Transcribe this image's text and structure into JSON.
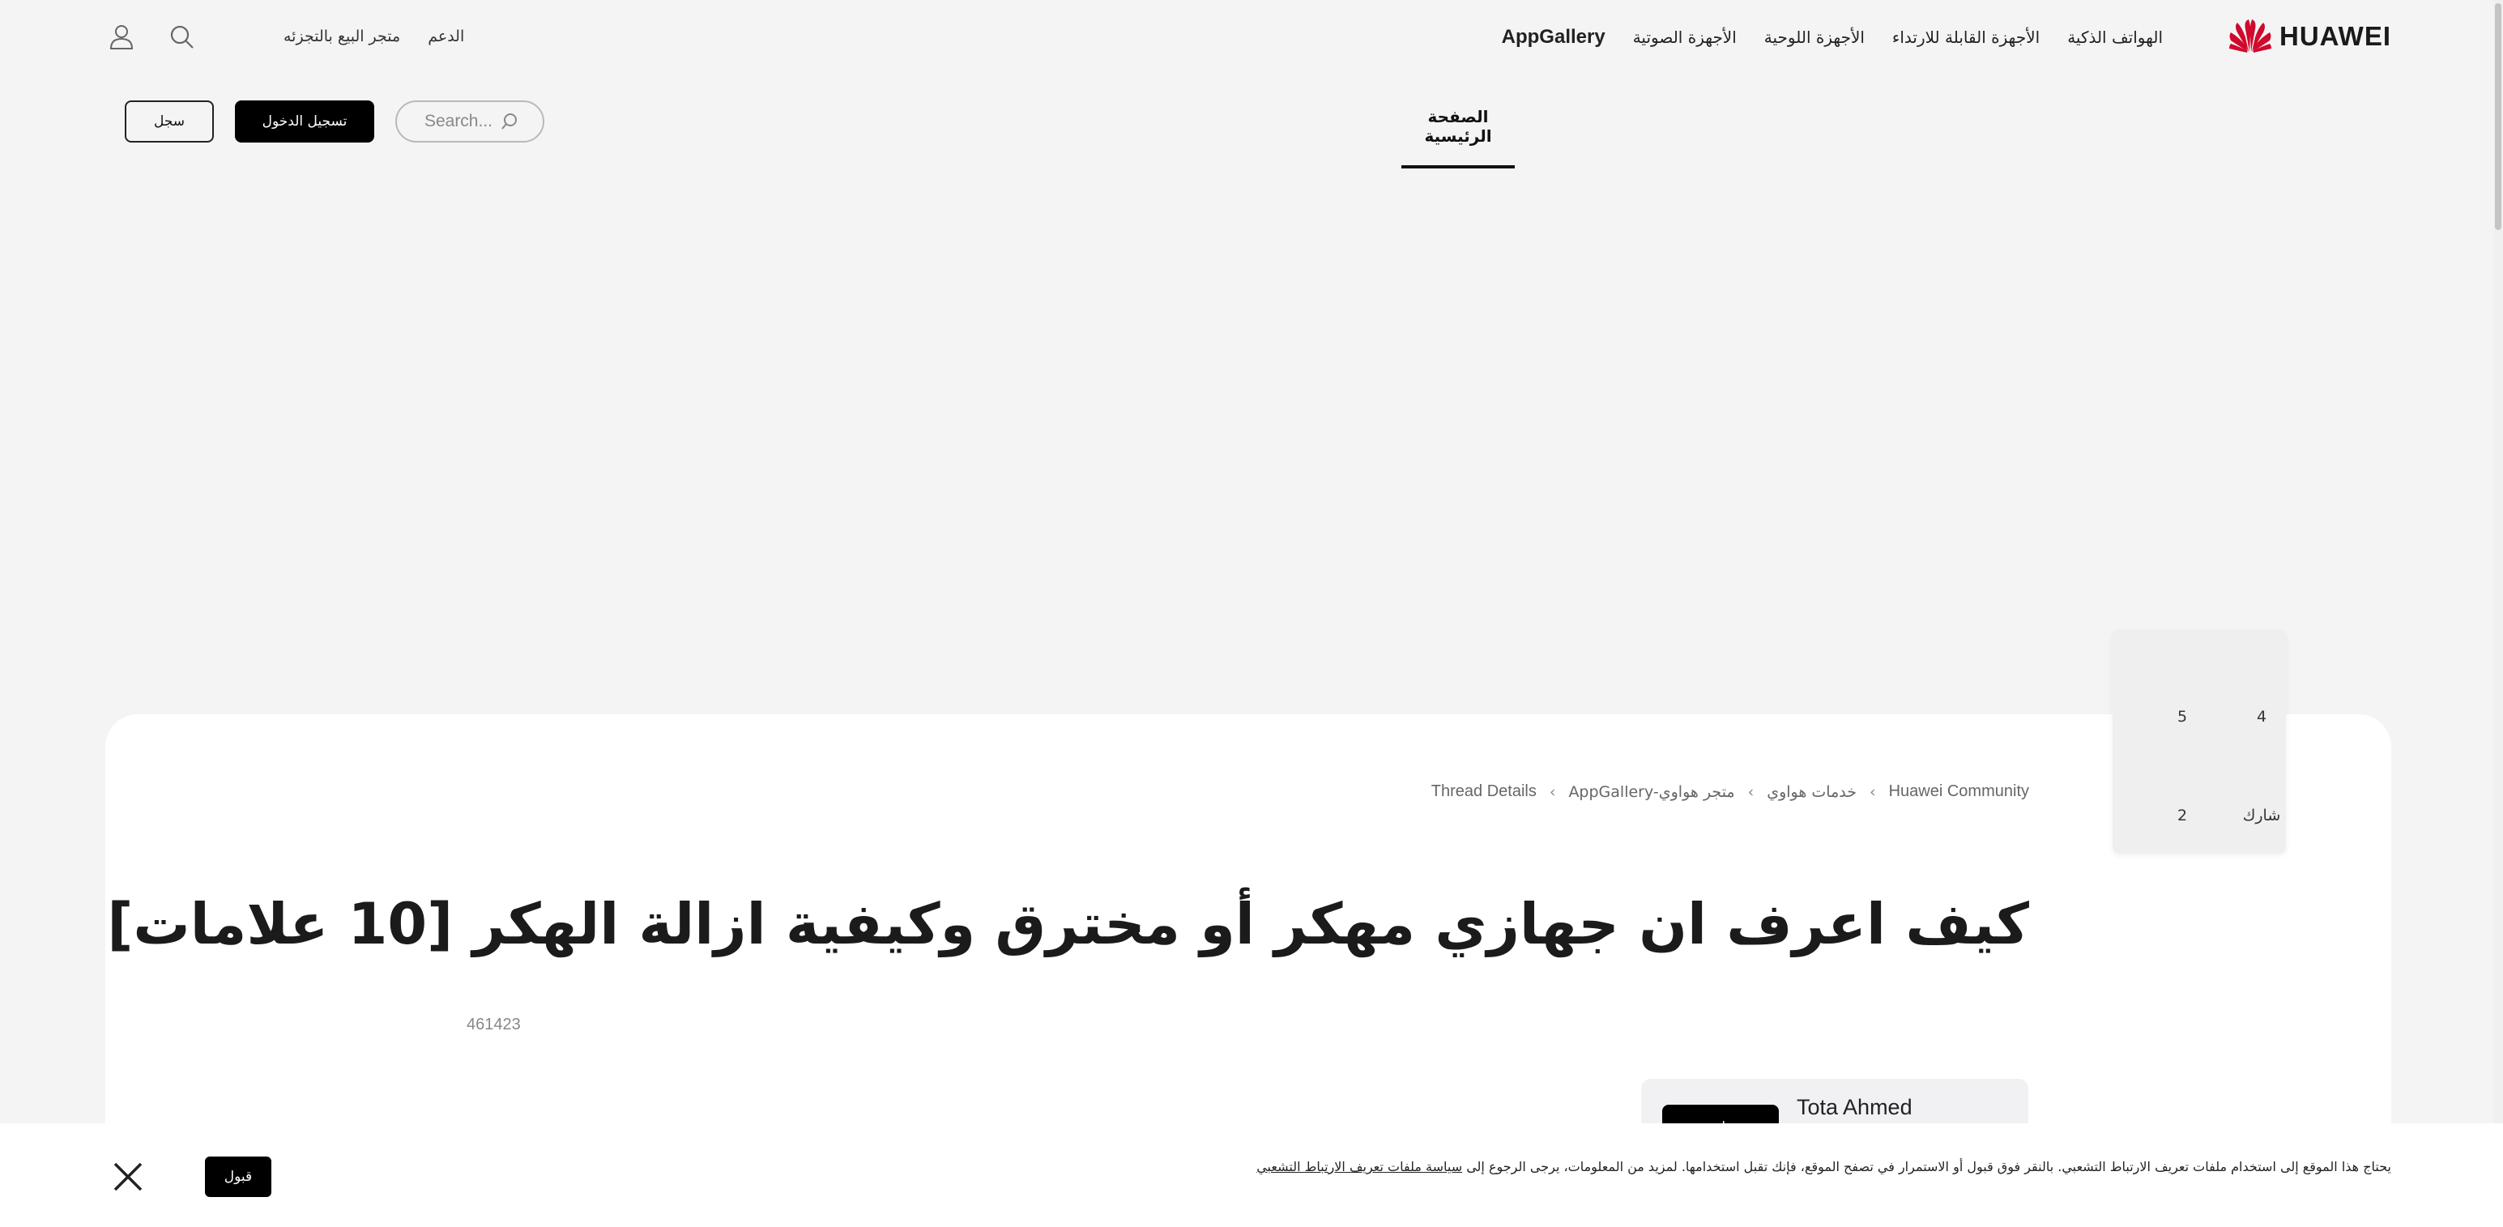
{
  "brand": {
    "name": "HUAWEI",
    "logo_icon": "huawei-petal-logo",
    "logo_color": "#cf0a2c"
  },
  "main_nav": [
    {
      "label": "الهواتف الذكية"
    },
    {
      "label": "الأجهزة القابلة للارتداء"
    },
    {
      "label": "الأجهزة اللوحية"
    },
    {
      "label": "الأجهزة الصوتية"
    },
    {
      "label": "AppGallery"
    }
  ],
  "utility_nav": {
    "support_label": "الدعم",
    "store_label": "متجر البيع بالتجزئه",
    "search_icon": "search-icon",
    "account_icon": "user-icon"
  },
  "sub_nav": {
    "home_tab": "الصفحة الرئيسية",
    "search_placeholder": "Search...",
    "login_label": "تسجيل الدخول",
    "register_label": "سجل"
  },
  "share_card": {
    "top_left": "5",
    "top_right": "4",
    "bottom_left": "2",
    "bottom_right": "شارك"
  },
  "breadcrumb": [
    {
      "label": "Huawei Community"
    },
    {
      "label": "خدمات هواوي"
    },
    {
      "label": "AppGallery-متجر هواوي"
    },
    {
      "label": "Thread Details"
    }
  ],
  "thread": {
    "title": "كيف اعرف ان جهازي مهكر أو مخترق وكيفية ازالة الهكر [10 علامات]",
    "views": "461423",
    "author_name": "Tota Ahmed",
    "follow_label": "متابعة"
  },
  "cookie_banner": {
    "text": "يحتاج هذا الموقع إلى استخدام ملفات تعريف الارتباط التشعبي. بالنقر فوق قبول أو الاستمرار في تصفح الموقع، فإنك تقبل استخدامها. لمزيد من المعلومات، يرجى الرجوع إلى ",
    "policy_link": "سياسة ملفات تعريف الارتباط التشعبي",
    "accept_label": "قبول",
    "close_icon": "close-icon"
  }
}
